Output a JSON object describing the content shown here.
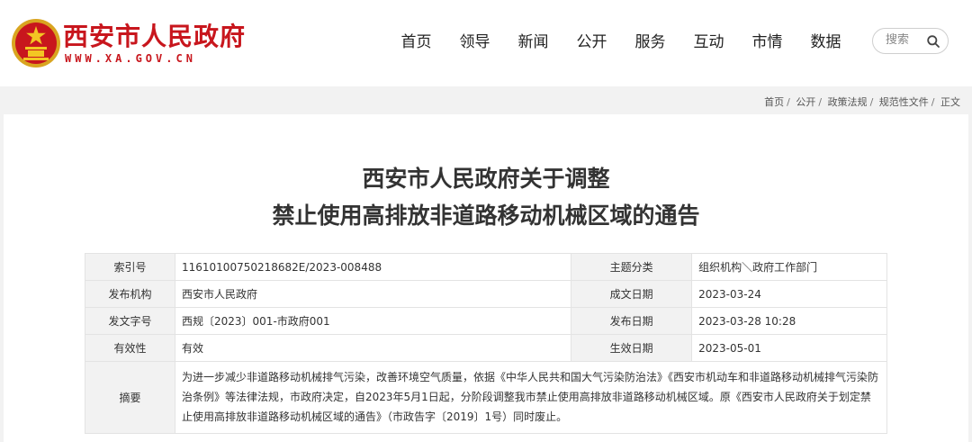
{
  "site": {
    "title": "西安市人民政府",
    "domain": "WWW.XA.GOV.CN",
    "brand_color": "#c8161d"
  },
  "nav": {
    "items": [
      "首页",
      "领导",
      "新闻",
      "公开",
      "服务",
      "互动",
      "市情",
      "数据"
    ]
  },
  "search": {
    "placeholder": "搜索",
    "icon": "search-icon"
  },
  "breadcrumb": [
    "首页",
    "公开",
    "政策法规",
    "规范性文件",
    "正文"
  ],
  "article": {
    "title_line1": "西安市人民政府关于调整",
    "title_line2": "禁止使用高排放非道路移动机械区域的通告"
  },
  "meta": {
    "rows": [
      {
        "label1": "索引号",
        "value1": "11610100750218682E/2023-008488",
        "label2": "主题分类",
        "value2": "组织机构＼政府工作部门"
      },
      {
        "label1": "发布机构",
        "value1": "西安市人民政府",
        "label2": "成文日期",
        "value2": "2023-03-24"
      },
      {
        "label1": "发文字号",
        "value1": "西规〔2023〕001-市政府001",
        "label2": "发布日期",
        "value2": "2023-03-28 10:28"
      },
      {
        "label1": "有效性",
        "value1": "有效",
        "label2": "生效日期",
        "value2": "2023-05-01"
      }
    ],
    "summary_label": "摘要",
    "summary": "为进一步减少非道路移动机械排气污染，改善环境空气质量，依据《中华人民共和国大气污染防治法》《西安市机动车和非道路移动机械排气污染防治条例》等法律法规，市政府决定，自2023年5月1日起，分阶段调整我市禁止使用高排放非道路移动机械区域。原《西安市人民政府关于划定禁止使用高排放非道路移动机械区域的通告》（市政告字〔2019〕1号）同时废止。"
  }
}
